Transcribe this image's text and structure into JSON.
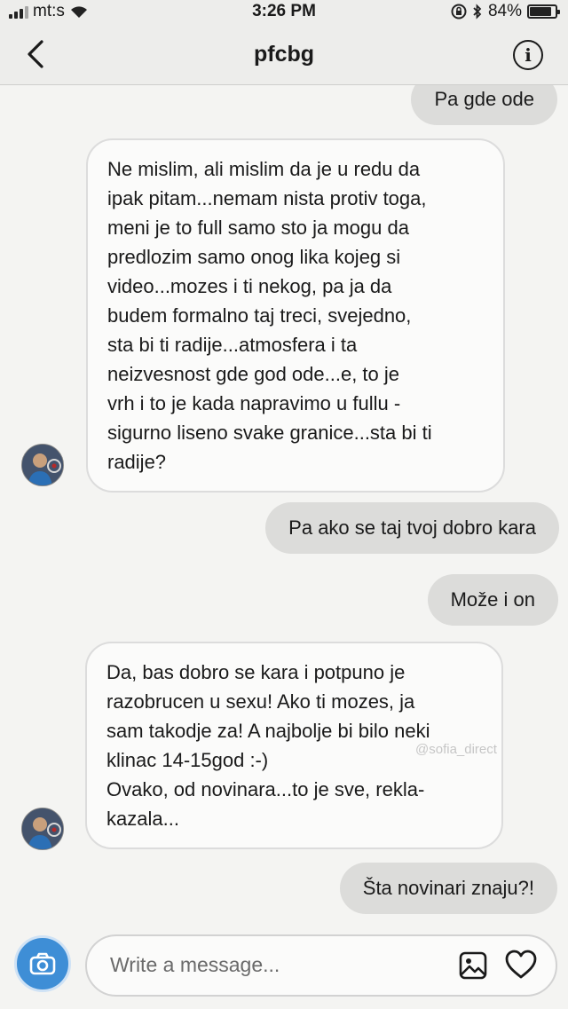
{
  "status_bar": {
    "carrier": "mt:s",
    "time": "3:26 PM",
    "battery": "84%",
    "battery_level": 0.84,
    "icons": [
      "signal-icon",
      "wifi-icon",
      "orientation-lock-icon",
      "bluetooth-icon",
      "battery-icon"
    ]
  },
  "header": {
    "title": "pfcbg",
    "back_icon": "chevron-left-icon",
    "info_icon": "info-icon",
    "info_glyph": "i"
  },
  "messages": [
    {
      "direction": "outgoing",
      "lines": [
        "Pa gde ode"
      ]
    },
    {
      "direction": "incoming",
      "lines": [
        "Ne mislim, ali mislim da je u redu da",
        "ipak pitam...nemam nista protiv toga,",
        "meni je to full samo sto ja mogu da",
        "predlozim samo onog lika kojeg si",
        "video...mozes i ti nekog, pa ja da",
        "budem formalno taj treci, svejedno,",
        "sta bi ti radije...atmosfera i ta",
        "neizvesnost gde god ode...e, to je",
        "vrh i to je kada napravimo u fullu -",
        "sigurno liseno svake granice...sta bi ti",
        "radije?"
      ]
    },
    {
      "direction": "outgoing",
      "lines": [
        "Pa ako se taj tvoj dobro kara"
      ]
    },
    {
      "direction": "outgoing",
      "lines": [
        "Može i on"
      ]
    },
    {
      "direction": "incoming",
      "lines": [
        "Da, bas dobro se kara i potpuno je",
        "razobrucen u sexu! Ako ti mozes, ja",
        "sam takodje za! A najbolje bi bilo neki",
        "klinac 14-15god :-)",
        "Ovako, od novinara...to je sve, rekla-",
        "kazala..."
      ]
    },
    {
      "direction": "outgoing",
      "lines": [
        "Šta novinari znaju?!"
      ]
    }
  ],
  "watermark": "@sofia_direct",
  "composer": {
    "placeholder": "Write a message...",
    "camera_icon": "camera-icon",
    "gallery_icon": "gallery-icon",
    "like_icon": "heart-icon",
    "accent": "#3e8ed6"
  }
}
